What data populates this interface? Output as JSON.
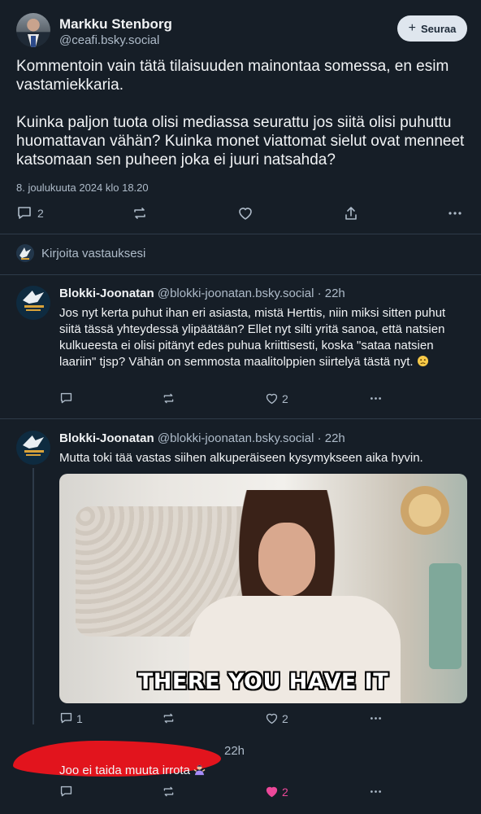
{
  "post": {
    "author_name": "Markku Stenborg",
    "author_handle": "@ceafi.bsky.social",
    "follow_label": "Seuraa",
    "text": "Kommentoin vain tätä tilaisuuden mainontaa somessa, en esim vastamiekkaria.\n\nKuinka paljon tuota olisi mediassa seurattu jos siitä olisi puhuttu huomattavan vähän? Kuinka monet viattomat sielut ovat menneet katsomaan sen puheen joka ei juuri natsahda?",
    "date": "8. joulukuuta 2024 klo 18.20",
    "reply_count": "2"
  },
  "compose": {
    "placeholder": "Kirjoita vastauksesi"
  },
  "replies": [
    {
      "name": "Blokki-Joonatan",
      "handle": "@blokki-joonatan.bsky.social",
      "dot": "·",
      "time": "22h",
      "text": "Jos nyt kerta puhut ihan eri asiasta, mistä Herttis, niin miksi sitten puhut siitä tässä yhteydessä ylipäätään? Ellet nyt silti yritä sanoa, että natsien kulkueesta ei olisi pitänyt edes puhua kriittisesti, koska \"sataa natsien laariin\" tjsp? Vähän on semmosta maalitolppien siirtelyä tästä nyt.",
      "like_count": "2"
    },
    {
      "name": "Blokki-Joonatan",
      "handle": "@blokki-joonatan.bsky.social",
      "dot": "·",
      "time": "22h",
      "text": "Mutta toki tää vastas siihen alkuperäiseen kysymykseen aika hyvin.",
      "gif_caption": "THERE YOU HAVE IT",
      "reply_count": "1",
      "like_count": "2"
    },
    {
      "time": "22h",
      "text": "Joo ei taida muuta irrota",
      "like_count": "2",
      "like_color": "#ec4899"
    }
  ],
  "colors": {
    "background": "#161e27",
    "muted": "#aebbc9",
    "divider": "#2e3b49"
  }
}
